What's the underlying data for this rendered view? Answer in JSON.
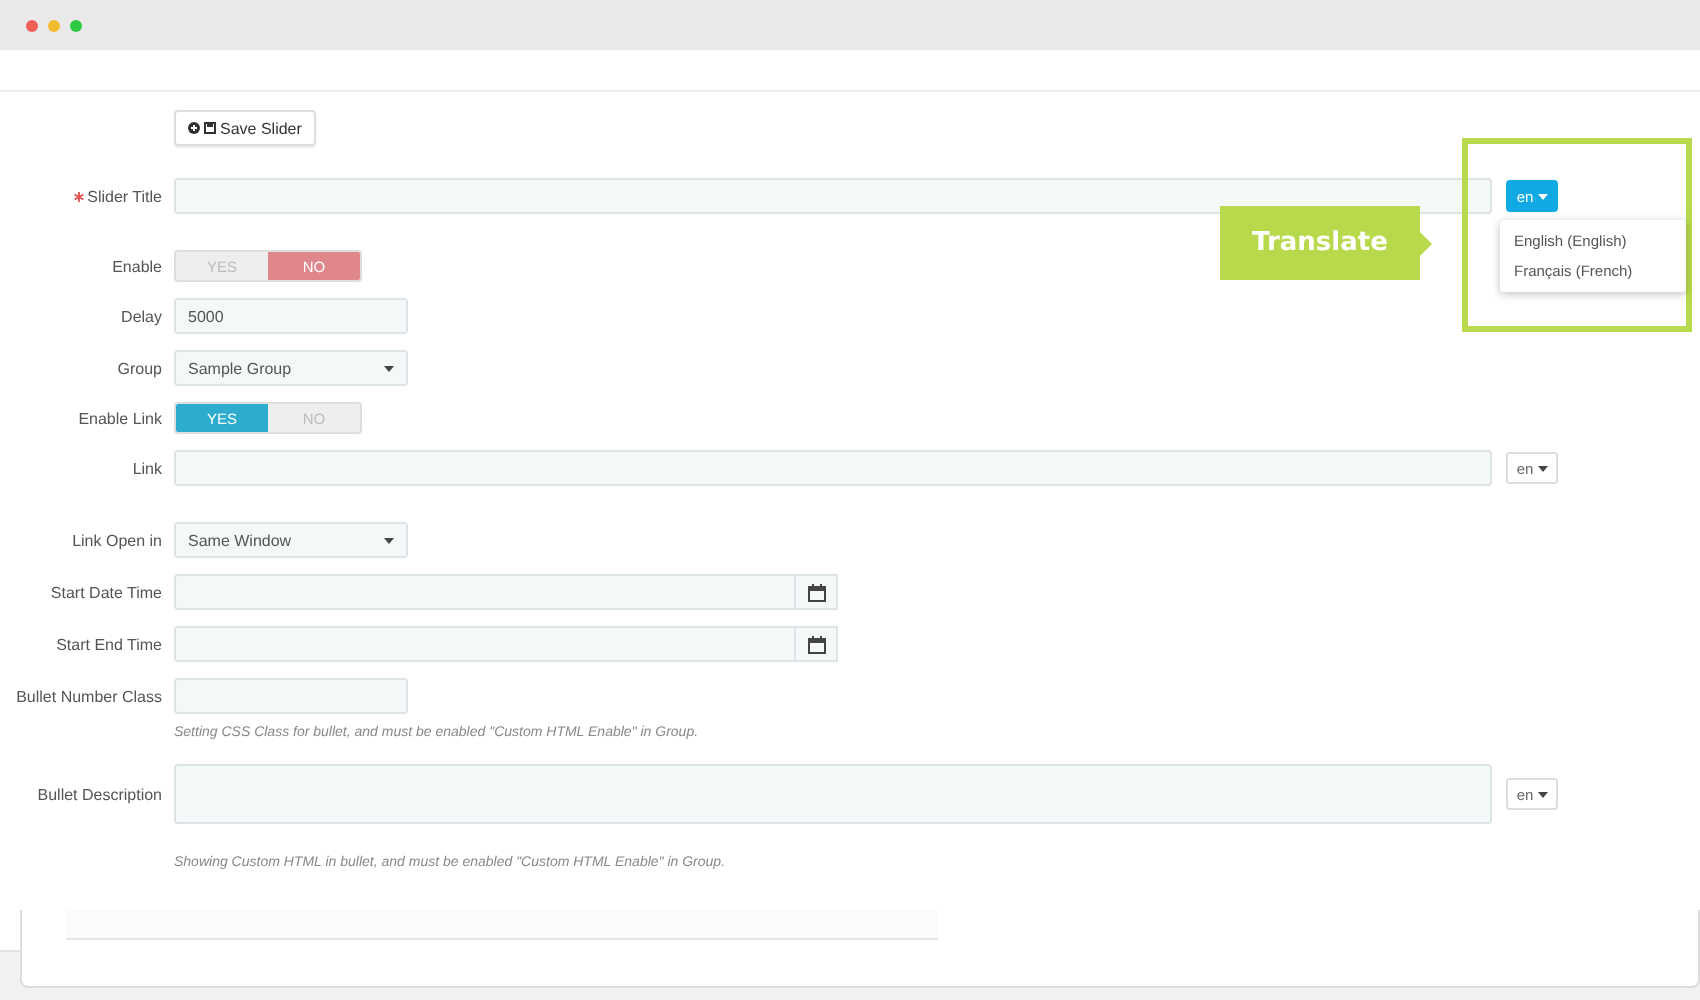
{
  "save_button": {
    "label": "Save Slider"
  },
  "callout": {
    "label": "Translate"
  },
  "fields": [
    {
      "kind": "text",
      "label": "Slider Title",
      "required": true,
      "lang": {
        "label": "en",
        "open": true,
        "items": [
          "English (English)",
          "Français (French)"
        ]
      }
    },
    {
      "kind": "toggle",
      "label": "Enable",
      "required": false,
      "options": [
        {
          "label": "YES",
          "selected": false
        },
        {
          "label": "NO",
          "selected": true
        }
      ]
    },
    {
      "kind": "short",
      "label": "Delay",
      "required": false,
      "value": "5000"
    },
    {
      "kind": "select",
      "label": "Group",
      "required": false,
      "value": "Sample Group"
    },
    {
      "kind": "toggle",
      "label": "Enable Link",
      "required": false,
      "options": [
        {
          "label": "YES",
          "selected": true
        },
        {
          "label": "NO",
          "selected": false
        }
      ]
    },
    {
      "kind": "text",
      "label": "Link",
      "required": false,
      "lang": {
        "label": "en",
        "open": false
      }
    },
    {
      "kind": "select",
      "label": "Link Open in",
      "required": false,
      "value": "Same Window"
    },
    {
      "kind": "date",
      "label": "Start Date Time",
      "required": false
    },
    {
      "kind": "date",
      "label": "Start End Time",
      "required": false
    },
    {
      "kind": "short",
      "label": "Bullet Number Class",
      "required": false,
      "help": "Setting CSS Class for bullet, and must be enabled \"Custom HTML Enable\" in Group."
    },
    {
      "kind": "textarea",
      "label": "Bullet Description",
      "required": false,
      "lang": {
        "label": "en",
        "open": false
      },
      "help": "Showing Custom HTML in bullet, and must be enabled \"Custom HTML Enable\" in Group."
    }
  ]
}
